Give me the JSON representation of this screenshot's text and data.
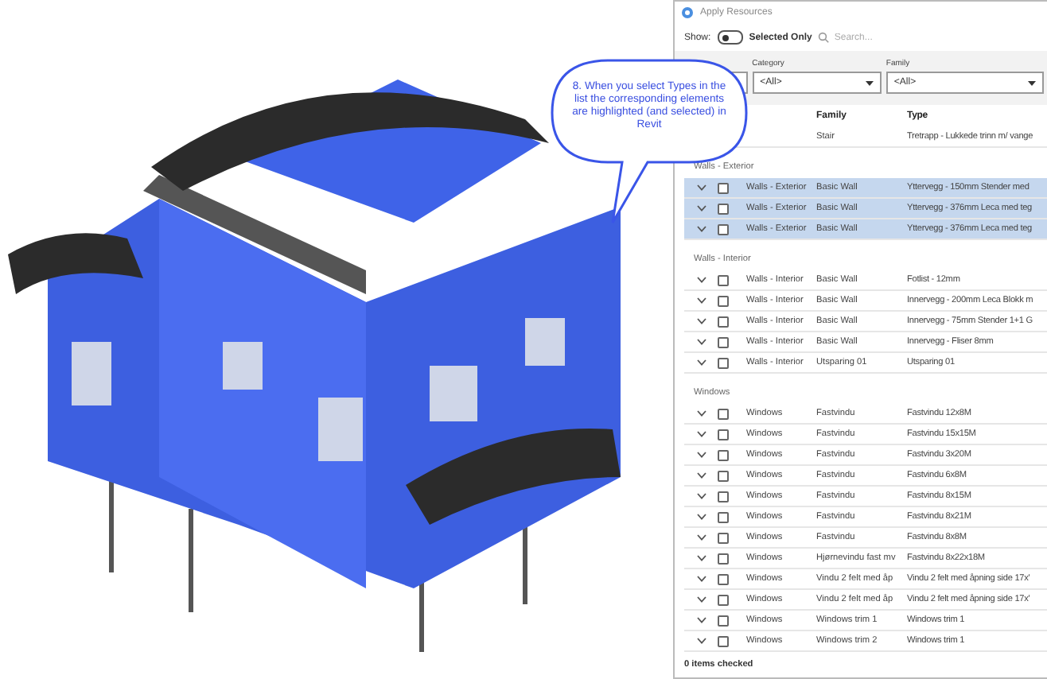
{
  "window": {
    "title": "Apply Resources"
  },
  "toolbar": {
    "show_label": "Show:",
    "toggle": {
      "label": "Selected Only",
      "on": false
    },
    "search": {
      "placeholder": "Search..."
    }
  },
  "filters": [
    {
      "kind": "dropdown"
    },
    {
      "kind": "dropdown",
      "label": "Category",
      "value": "<All>"
    },
    {
      "kind": "dropdown",
      "label": "Family",
      "value": "<All>"
    }
  ],
  "table": {
    "columns": [
      "Family",
      "Type"
    ],
    "groups": [
      {
        "rows": [
          {
            "family": "Stair",
            "type": "Tretrapp - Lukkede trinn m/ vange",
            "selected": false
          }
        ]
      },
      {
        "name": "Walls - Exterior",
        "rows": [
          {
            "category": "Walls - Exterior",
            "family": "Basic Wall",
            "type": "Yttervegg - 150mm Stender med",
            "checked": false,
            "selected": true
          },
          {
            "category": "Walls - Exterior",
            "family": "Basic Wall",
            "type": "Yttervegg - 376mm Leca med teg",
            "checked": false,
            "selected": true
          },
          {
            "category": "Walls - Exterior",
            "family": "Basic Wall",
            "type": "Yttervegg - 376mm Leca med teg",
            "checked": false,
            "selected": true
          }
        ]
      },
      {
        "name": "Walls - Interior",
        "rows": [
          {
            "category": "Walls - Interior",
            "family": "Basic Wall",
            "type": "Fotlist - 12mm",
            "checked": false,
            "selected": false
          },
          {
            "category": "Walls - Interior",
            "family": "Basic Wall",
            "type": "Innervegg - 200mm Leca Blokk m",
            "checked": false,
            "selected": false
          },
          {
            "category": "Walls - Interior",
            "family": "Basic Wall",
            "type": "Innervegg - 75mm Stender 1+1 G",
            "checked": false,
            "selected": false
          },
          {
            "category": "Walls - Interior",
            "family": "Basic Wall",
            "type": "Innervegg - Fliser 8mm",
            "checked": false,
            "selected": false
          },
          {
            "category": "Walls - Interior",
            "family": "Utsparing 01",
            "type": "Utsparing 01",
            "checked": false,
            "selected": false
          }
        ]
      },
      {
        "name": "Windows",
        "rows": [
          {
            "category": "Windows",
            "family": "Fastvindu",
            "type": "Fastvindu 12x8M",
            "checked": false,
            "selected": false
          },
          {
            "category": "Windows",
            "family": "Fastvindu",
            "type": "Fastvindu 15x15M",
            "checked": false,
            "selected": false
          },
          {
            "category": "Windows",
            "family": "Fastvindu",
            "type": "Fastvindu 3x20M",
            "checked": false,
            "selected": false
          },
          {
            "category": "Windows",
            "family": "Fastvindu",
            "type": "Fastvindu 6x8M",
            "checked": false,
            "selected": false
          },
          {
            "category": "Windows",
            "family": "Fastvindu",
            "type": "Fastvindu 8x15M",
            "checked": false,
            "selected": false
          },
          {
            "category": "Windows",
            "family": "Fastvindu",
            "type": "Fastvindu 8x21M",
            "checked": false,
            "selected": false
          },
          {
            "category": "Windows",
            "family": "Fastvindu",
            "type": "Fastvindu 8x8M",
            "checked": false,
            "selected": false
          },
          {
            "category": "Windows",
            "family": "Hjørnevindu fast mv",
            "type": "Fastvindu 8x22x18M",
            "checked": false,
            "selected": false
          },
          {
            "category": "Windows",
            "family": "Vindu 2 felt med åp",
            "type": "Vindu 2 felt med åpning side 17x'",
            "checked": false,
            "selected": false
          },
          {
            "category": "Windows",
            "family": "Vindu 2 felt med åp",
            "type": "Vindu 2 felt med åpning side 17x'",
            "checked": false,
            "selected": false
          },
          {
            "category": "Windows",
            "family": "Windows trim 1",
            "type": "Windows trim 1",
            "checked": false,
            "selected": false
          },
          {
            "category": "Windows",
            "family": "Windows trim 2",
            "type": "Windows trim 1",
            "checked": false,
            "selected": false
          }
        ]
      }
    ]
  },
  "status_bar": "0 items checked",
  "callout": "8. When you select Types in the list the corresponding elements are highlighted (and selected) in Revit"
}
